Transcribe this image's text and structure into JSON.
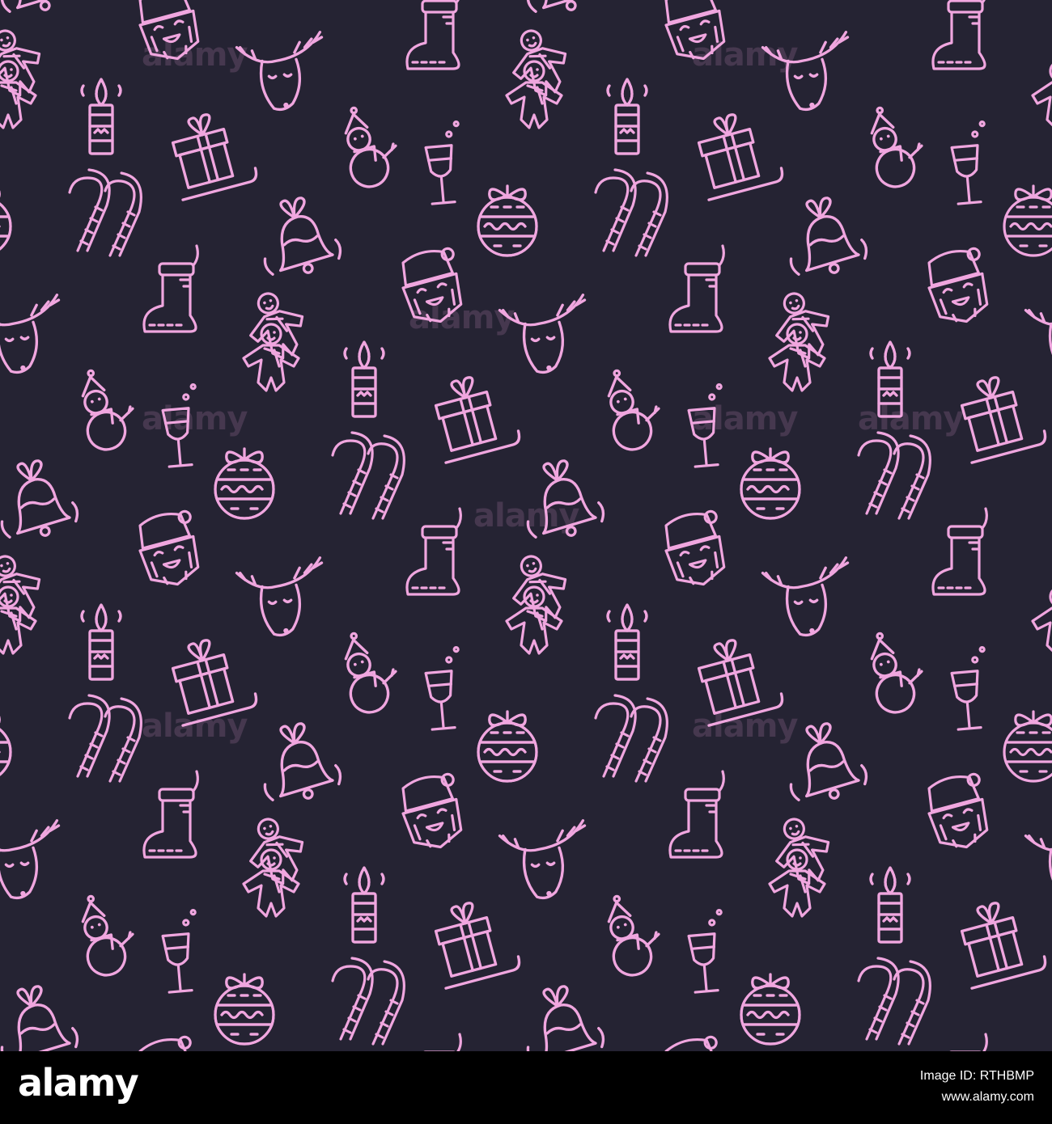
{
  "pattern": {
    "background_color": "#252333",
    "icon_color": "#f0a6df",
    "icons": [
      "santa-face-icon",
      "christmas-stocking-icon",
      "reindeer-head-icon",
      "gingerbread-man-icon",
      "candle-icon",
      "gift-box-icon",
      "snowman-icon",
      "champagne-glass-icon",
      "christmas-ornament-icon",
      "candy-cane-icon",
      "jingle-bell-icon"
    ],
    "watermark_text": "alamy"
  },
  "footer": {
    "logo": "alamy",
    "image_id_line": "Image ID: RTHBMP",
    "site": "www.alamy.com",
    "background_color": "#000000"
  }
}
